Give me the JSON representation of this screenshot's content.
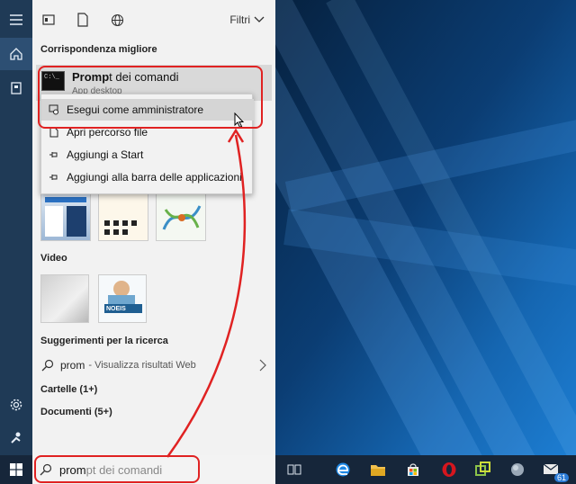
{
  "panel": {
    "filter_label": "Filtri",
    "best_match_header": "Corrispondenza migliore",
    "best_match": {
      "title_bold": "Promp",
      "title_rest": "t dei comandi",
      "subtitle": "App desktop"
    },
    "context_menu": [
      {
        "label": "Esegui come amministratore",
        "highlighted": true
      },
      {
        "label": "Apri percorso file"
      },
      {
        "label": "Aggiungi a Start"
      },
      {
        "label": "Aggiungi alla barra delle applicazioni"
      }
    ],
    "video_header": "Video",
    "suggestions_header": "Suggerimenti per la ricerca",
    "suggestion": {
      "query": "prom",
      "description": "- Visualizza risultati Web"
    },
    "folders": "Cartelle (1+)",
    "documents": "Documenti (5+)",
    "thumb_logo_text": "NOEIS"
  },
  "taskbar": {
    "search_typed": "prom",
    "search_completion": "pt dei comandi",
    "mail_badge": "61"
  },
  "colors": {
    "annotation": "#e02222",
    "rail": "#1f3a56",
    "taskbar": "#16263a"
  }
}
